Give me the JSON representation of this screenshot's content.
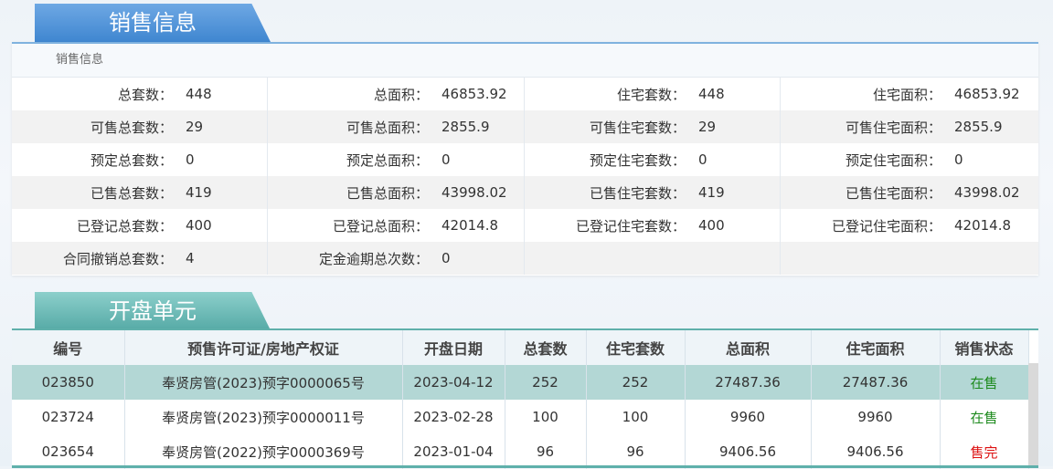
{
  "sales_section": {
    "tab_title": "销售信息",
    "panel_title": "销售信息",
    "rows": [
      [
        {
          "label": "总套数：",
          "value": "448"
        },
        {
          "label": "总面积：",
          "value": "46853.92"
        },
        {
          "label": "住宅套数：",
          "value": "448"
        },
        {
          "label": "住宅面积：",
          "value": "46853.92"
        }
      ],
      [
        {
          "label": "可售总套数：",
          "value": "29"
        },
        {
          "label": "可售总面积：",
          "value": "2855.9"
        },
        {
          "label": "可售住宅套数：",
          "value": "29"
        },
        {
          "label": "可售住宅面积：",
          "value": "2855.9"
        }
      ],
      [
        {
          "label": "预定总套数：",
          "value": "0"
        },
        {
          "label": "预定总面积：",
          "value": "0"
        },
        {
          "label": "预定住宅套数：",
          "value": "0"
        },
        {
          "label": "预定住宅面积：",
          "value": "0"
        }
      ],
      [
        {
          "label": "已售总套数：",
          "value": "419"
        },
        {
          "label": "已售总面积：",
          "value": "43998.02"
        },
        {
          "label": "已售住宅套数：",
          "value": "419"
        },
        {
          "label": "已售住宅面积：",
          "value": "43998.02"
        }
      ],
      [
        {
          "label": "已登记总套数：",
          "value": "400"
        },
        {
          "label": "已登记总面积：",
          "value": "42014.8"
        },
        {
          "label": "已登记住宅套数：",
          "value": "400"
        },
        {
          "label": "已登记住宅面积：",
          "value": "42014.8"
        }
      ],
      [
        {
          "label": "合同撤销总套数：",
          "value": "4"
        },
        {
          "label": "定金逾期总次数：",
          "value": "0"
        },
        {
          "label": "",
          "value": ""
        },
        {
          "label": "",
          "value": ""
        }
      ]
    ]
  },
  "units_section": {
    "tab_title": "开盘单元",
    "headers": [
      "编号",
      "预售许可证/房地产权证",
      "开盘日期",
      "总套数",
      "住宅套数",
      "总面积",
      "住宅面积",
      "销售状态"
    ],
    "rows": [
      {
        "id": "023850",
        "permit": "奉贤房管(2023)预字0000065号",
        "date": "2023-04-12",
        "total": "252",
        "residential": "252",
        "area": "27487.36",
        "res_area": "27487.36",
        "status": "在售",
        "status_color": "#1d8a1d"
      },
      {
        "id": "023724",
        "permit": "奉贤房管(2023)预字0000011号",
        "date": "2023-02-28",
        "total": "100",
        "residential": "100",
        "area": "9960",
        "res_area": "9960",
        "status": "在售",
        "status_color": "#1d8a1d"
      },
      {
        "id": "023654",
        "permit": "奉贤房管(2022)预字0000369号",
        "date": "2023-01-04",
        "total": "96",
        "residential": "96",
        "area": "9406.56",
        "res_area": "9406.56",
        "status": "售完",
        "status_color": "#dd1111"
      }
    ]
  }
}
